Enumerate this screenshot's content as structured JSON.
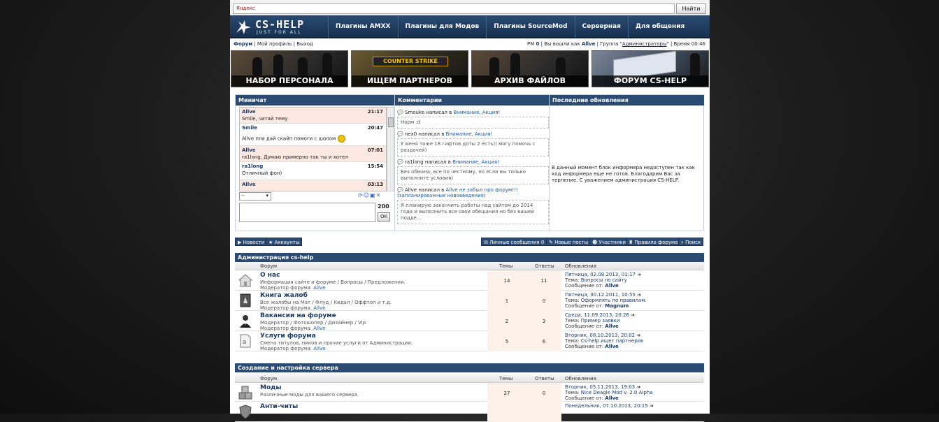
{
  "search": {
    "placeholder": "Яндекс",
    "button": "Найти"
  },
  "logo": {
    "big": "CS-HELP",
    "small": "JUST FOR ALL"
  },
  "nav": [
    "Плагины AMXX",
    "Плагины для Модов",
    "Плагины SourceMod",
    "Серверная",
    "Для общения"
  ],
  "userbar": {
    "forum": "Форум",
    "profile": "Мой профиль",
    "logout": "Выход",
    "pm_label": "PM",
    "pm_count": "0",
    "logged_as": "Вы вошли как",
    "user": "Allve",
    "group_label": "Группа",
    "group": "Администраторы",
    "time_label": "Время",
    "time": "00:46"
  },
  "banners": [
    "НАБОР ПЕРСОНАЛА",
    "ИЩЕМ ПАРТНЕРОВ",
    "АРХИВ ФАЙЛОВ",
    "ФОРУМ CS-HELP"
  ],
  "counter_strike_logo": "COUNTER STRIKE",
  "blocks": {
    "minichat": "Миничат",
    "comments": "Комментарии",
    "updates": "Последние обновления"
  },
  "chat": [
    {
      "name": "Allve",
      "time": "21:17",
      "text": "Smile, читай тему",
      "alt": true
    },
    {
      "name": "Smile",
      "time": "20:47",
      "text": "Allve пла дай скайп помоги с шопом",
      "alt": false
    },
    {
      "name": "Allve",
      "time": "07:01",
      "text": "ra1long, Думаю примерно так ты и хотел",
      "alt": true
    },
    {
      "name": "ra1long",
      "time": "15:54",
      "text": "Отличный фон)",
      "alt": false
    },
    {
      "name": "Allve",
      "time": "03:13",
      "text": "",
      "alt": true
    }
  ],
  "chat_select": "--",
  "chat_count": "200",
  "chat_ok": "OK",
  "comments": [
    {
      "who": "Smouke",
      "action": "написал в",
      "target": "Внимание, Акция!",
      "body": "Норм :d"
    },
    {
      "who": "nex0",
      "action": "написал в",
      "target": "Внимание, Акция!",
      "body": "У меня тоже 18 гифтов доты 2 есть)) могу помочь с раздачей)"
    },
    {
      "who": "ra1long",
      "action": "написал в",
      "target": "Внимание, Акция!",
      "body": "Без обмана, все по честному, но если вы только выполните условия)"
    },
    {
      "who": "Allve",
      "action": "написал в",
      "target": "Allve не забыл про форум!!! (запланированные нововведения)",
      "body": "Я планирую закончить работы над сайтом до 2014 года и выполнить все свои обещания но без вашей подде..."
    }
  ],
  "updates_text": "В данный момент блок информера недоступен так как код информера еще не готов. Благодарим Вас за терпение. С уважением администрация CS-HELP.",
  "left_buttons": [
    "Новости",
    "Аккаунты"
  ],
  "right_buttons": [
    "Личные сообщения 0",
    "Новые посты",
    "Участники",
    "Правила форума",
    "Поиск"
  ],
  "columns": {
    "forum": "Форум",
    "topics": "Темы",
    "replies": "Ответы",
    "updates": "Обновления"
  },
  "categories": [
    {
      "title": "Администрация cs-help",
      "forums": [
        {
          "name": "О нас",
          "desc": "Информация сайте и форуме / Вопросы / Предложения.",
          "mod_label": "Модератор форума:",
          "mod": "Allve",
          "topics": "14",
          "replies": "11",
          "date": "Пятница, 02.08.2013, 01:17",
          "topic_label": "Тема:",
          "topic": "Вопросы по сайту",
          "msg_label": "Сообщение от:",
          "author": "Allve",
          "icon": "house-icon"
        },
        {
          "name": "Книга жалоб",
          "desc": "Все жалобы на Мат / Флуд / Кидал / Оффтоп и т.д.",
          "mod_label": "Модератор форума:",
          "mod": "Allve",
          "topics": "1",
          "replies": "0",
          "date": "Пятница, 30.12.2011, 10:55",
          "topic_label": "Тема:",
          "topic": "Оформлять по правилам.",
          "msg_label": "Сообщение от:",
          "author": "Magnum",
          "icon": "book-icon"
        },
        {
          "name": "Вакансии на форуме",
          "desc": "Модератор / Фотошопер / Дизайнер / Vip.",
          "mod_label": "Модератор форума:",
          "mod": "Allve",
          "topics": "2",
          "replies": "3",
          "date": "Среда, 11.09.2013, 20:26",
          "topic_label": "Тема:",
          "topic": "Пример заявки",
          "msg_label": "Сообщение от:",
          "author": "Allve",
          "icon": "agent-icon"
        },
        {
          "name": "Услуги форума",
          "desc": "Смена титулов, ников и прочие услуги от Администрации.",
          "mod_label": "Модератор форума:",
          "mod": "Allve",
          "topics": "5",
          "replies": "6",
          "date": "Вторник, 08.10.2013, 20:02",
          "topic_label": "Тема:",
          "topic": "Cs-help ищет партнеров",
          "msg_label": "Сообщение от:",
          "author": "Allve",
          "icon": "document-icon"
        }
      ]
    },
    {
      "title": "Создание и настройка сервера",
      "forums": [
        {
          "name": "Моды",
          "desc": "Различные моды для вашего сервера.",
          "mod_label": "",
          "mod": "",
          "topics": "27",
          "replies": "0",
          "date": "Вторник, 05.11.2013, 19:03",
          "topic_label": "Тема:",
          "topic": "Nice Deagle Mod v. 2.0 Alpha",
          "msg_label": "Сообщение от:",
          "author": "Allve",
          "icon": "boxes-icon"
        },
        {
          "name": "Анти-читы",
          "desc": "",
          "mod_label": "",
          "mod": "",
          "topics": "",
          "replies": "",
          "date": "Понедельник, 07.10.2013, 20:15",
          "topic_label": "",
          "topic": "",
          "msg_label": "",
          "author": "",
          "icon": "shield-icon"
        }
      ]
    }
  ]
}
